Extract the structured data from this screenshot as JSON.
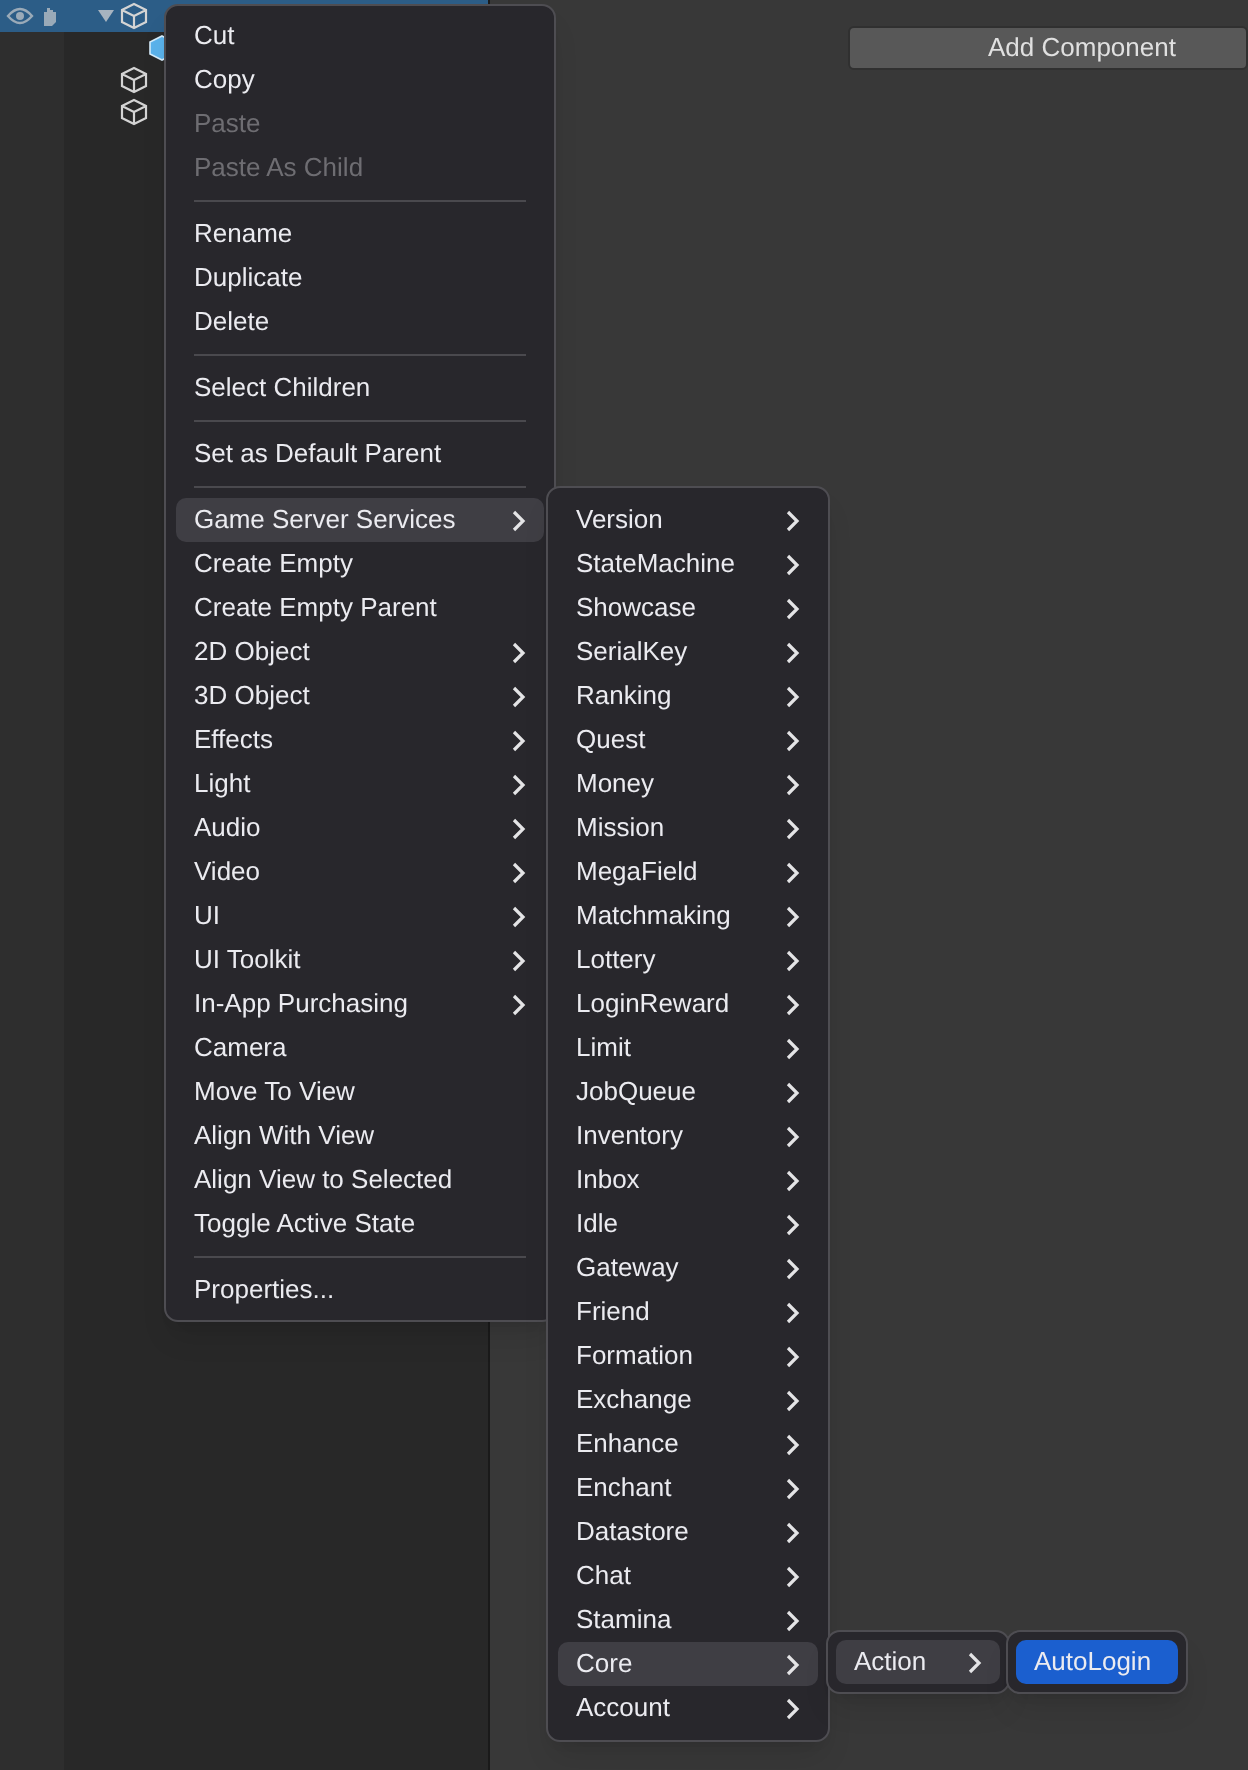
{
  "hierarchy": {
    "rows": [
      {
        "selected": true,
        "expanded": true,
        "kind": "object",
        "children": [
          {
            "selected": false,
            "kind": "prefab"
          }
        ]
      },
      {
        "selected": false,
        "kind": "object"
      },
      {
        "selected": false,
        "kind": "object"
      }
    ]
  },
  "inspector": {
    "add_button": "Add Component"
  },
  "context_menu": [
    {
      "kind": "item",
      "label": "Cut",
      "disabled": false,
      "submenu": false,
      "selected": false
    },
    {
      "kind": "item",
      "label": "Copy",
      "disabled": false,
      "submenu": false,
      "selected": false
    },
    {
      "kind": "item",
      "label": "Paste",
      "disabled": true,
      "submenu": false,
      "selected": false
    },
    {
      "kind": "item",
      "label": "Paste As Child",
      "disabled": true,
      "submenu": false,
      "selected": false
    },
    {
      "kind": "separator"
    },
    {
      "kind": "item",
      "label": "Rename",
      "disabled": false,
      "submenu": false,
      "selected": false
    },
    {
      "kind": "item",
      "label": "Duplicate",
      "disabled": false,
      "submenu": false,
      "selected": false
    },
    {
      "kind": "item",
      "label": "Delete",
      "disabled": false,
      "submenu": false,
      "selected": false
    },
    {
      "kind": "separator"
    },
    {
      "kind": "item",
      "label": "Select Children",
      "disabled": false,
      "submenu": false,
      "selected": false
    },
    {
      "kind": "separator"
    },
    {
      "kind": "item",
      "label": "Set as Default Parent",
      "disabled": false,
      "submenu": false,
      "selected": false
    },
    {
      "kind": "separator"
    },
    {
      "kind": "item",
      "label": "Game Server Services",
      "disabled": false,
      "submenu": true,
      "selected": true
    },
    {
      "kind": "item",
      "label": "Create Empty",
      "disabled": false,
      "submenu": false,
      "selected": false
    },
    {
      "kind": "item",
      "label": "Create Empty Parent",
      "disabled": false,
      "submenu": false,
      "selected": false
    },
    {
      "kind": "item",
      "label": "2D Object",
      "disabled": false,
      "submenu": true,
      "selected": false
    },
    {
      "kind": "item",
      "label": "3D Object",
      "disabled": false,
      "submenu": true,
      "selected": false
    },
    {
      "kind": "item",
      "label": "Effects",
      "disabled": false,
      "submenu": true,
      "selected": false
    },
    {
      "kind": "item",
      "label": "Light",
      "disabled": false,
      "submenu": true,
      "selected": false
    },
    {
      "kind": "item",
      "label": "Audio",
      "disabled": false,
      "submenu": true,
      "selected": false
    },
    {
      "kind": "item",
      "label": "Video",
      "disabled": false,
      "submenu": true,
      "selected": false
    },
    {
      "kind": "item",
      "label": "UI",
      "disabled": false,
      "submenu": true,
      "selected": false
    },
    {
      "kind": "item",
      "label": "UI Toolkit",
      "disabled": false,
      "submenu": true,
      "selected": false
    },
    {
      "kind": "item",
      "label": "In-App Purchasing",
      "disabled": false,
      "submenu": true,
      "selected": false
    },
    {
      "kind": "item",
      "label": "Camera",
      "disabled": false,
      "submenu": false,
      "selected": false
    },
    {
      "kind": "item",
      "label": "Move To View",
      "disabled": false,
      "submenu": false,
      "selected": false
    },
    {
      "kind": "item",
      "label": "Align With View",
      "disabled": false,
      "submenu": false,
      "selected": false
    },
    {
      "kind": "item",
      "label": "Align View to Selected",
      "disabled": false,
      "submenu": false,
      "selected": false
    },
    {
      "kind": "item",
      "label": "Toggle Active State",
      "disabled": false,
      "submenu": false,
      "selected": false
    },
    {
      "kind": "separator"
    },
    {
      "kind": "item",
      "label": "Properties...",
      "disabled": false,
      "submenu": false,
      "selected": false
    }
  ],
  "services_menu": [
    {
      "label": "Version",
      "selected": false
    },
    {
      "label": "StateMachine",
      "selected": false
    },
    {
      "label": "Showcase",
      "selected": false
    },
    {
      "label": "SerialKey",
      "selected": false
    },
    {
      "label": "Ranking",
      "selected": false
    },
    {
      "label": "Quest",
      "selected": false
    },
    {
      "label": "Money",
      "selected": false
    },
    {
      "label": "Mission",
      "selected": false
    },
    {
      "label": "MegaField",
      "selected": false
    },
    {
      "label": "Matchmaking",
      "selected": false
    },
    {
      "label": "Lottery",
      "selected": false
    },
    {
      "label": "LoginReward",
      "selected": false
    },
    {
      "label": "Limit",
      "selected": false
    },
    {
      "label": "JobQueue",
      "selected": false
    },
    {
      "label": "Inventory",
      "selected": false
    },
    {
      "label": "Inbox",
      "selected": false
    },
    {
      "label": "Idle",
      "selected": false
    },
    {
      "label": "Gateway",
      "selected": false
    },
    {
      "label": "Friend",
      "selected": false
    },
    {
      "label": "Formation",
      "selected": false
    },
    {
      "label": "Exchange",
      "selected": false
    },
    {
      "label": "Enhance",
      "selected": false
    },
    {
      "label": "Enchant",
      "selected": false
    },
    {
      "label": "Datastore",
      "selected": false
    },
    {
      "label": "Chat",
      "selected": false
    },
    {
      "label": "Stamina",
      "selected": false
    },
    {
      "label": "Core",
      "selected": true
    },
    {
      "label": "Account",
      "selected": false
    }
  ],
  "core_menu": [
    {
      "label": "Action",
      "selected": true
    }
  ],
  "action_menu": [
    {
      "label": "AutoLogin",
      "selected": true,
      "submenu": false
    }
  ]
}
